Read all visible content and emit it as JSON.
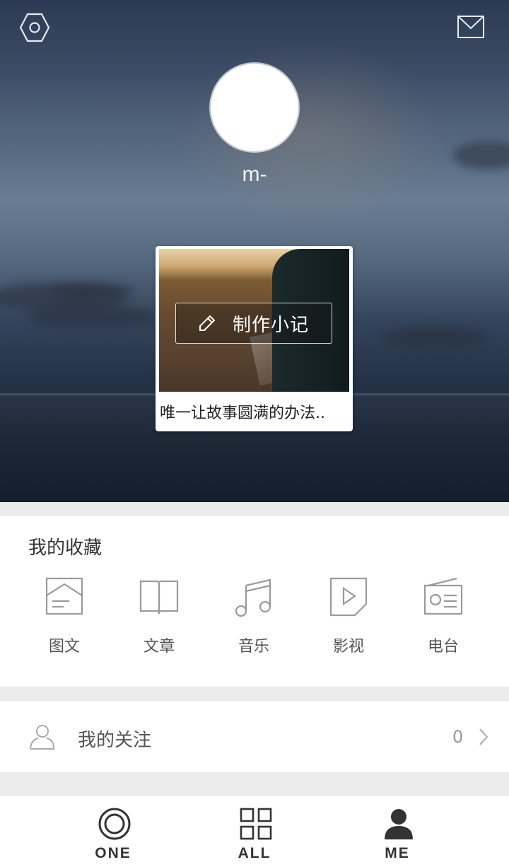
{
  "profile": {
    "username": "m-"
  },
  "note_card": {
    "button_label": "制作小记",
    "caption": "唯一让故事圆满的办法.."
  },
  "favorites": {
    "title": "我的收藏",
    "items": [
      {
        "label": "图文",
        "icon": "picture-text-icon"
      },
      {
        "label": "文章",
        "icon": "book-icon"
      },
      {
        "label": "音乐",
        "icon": "music-note-icon"
      },
      {
        "label": "影视",
        "icon": "video-play-icon"
      },
      {
        "label": "电台",
        "icon": "radio-icon"
      }
    ]
  },
  "follow": {
    "label": "我的关注",
    "count": "0"
  },
  "bottom_nav": {
    "items": [
      {
        "label": "ONE",
        "icon": "one-circle-icon"
      },
      {
        "label": "ALL",
        "icon": "grid-icon"
      },
      {
        "label": "ME",
        "icon": "person-icon",
        "active": true
      }
    ]
  },
  "colors": {
    "icon_gray": "#9a9a9a",
    "text_dark": "#333333",
    "divider": "#ececec"
  }
}
